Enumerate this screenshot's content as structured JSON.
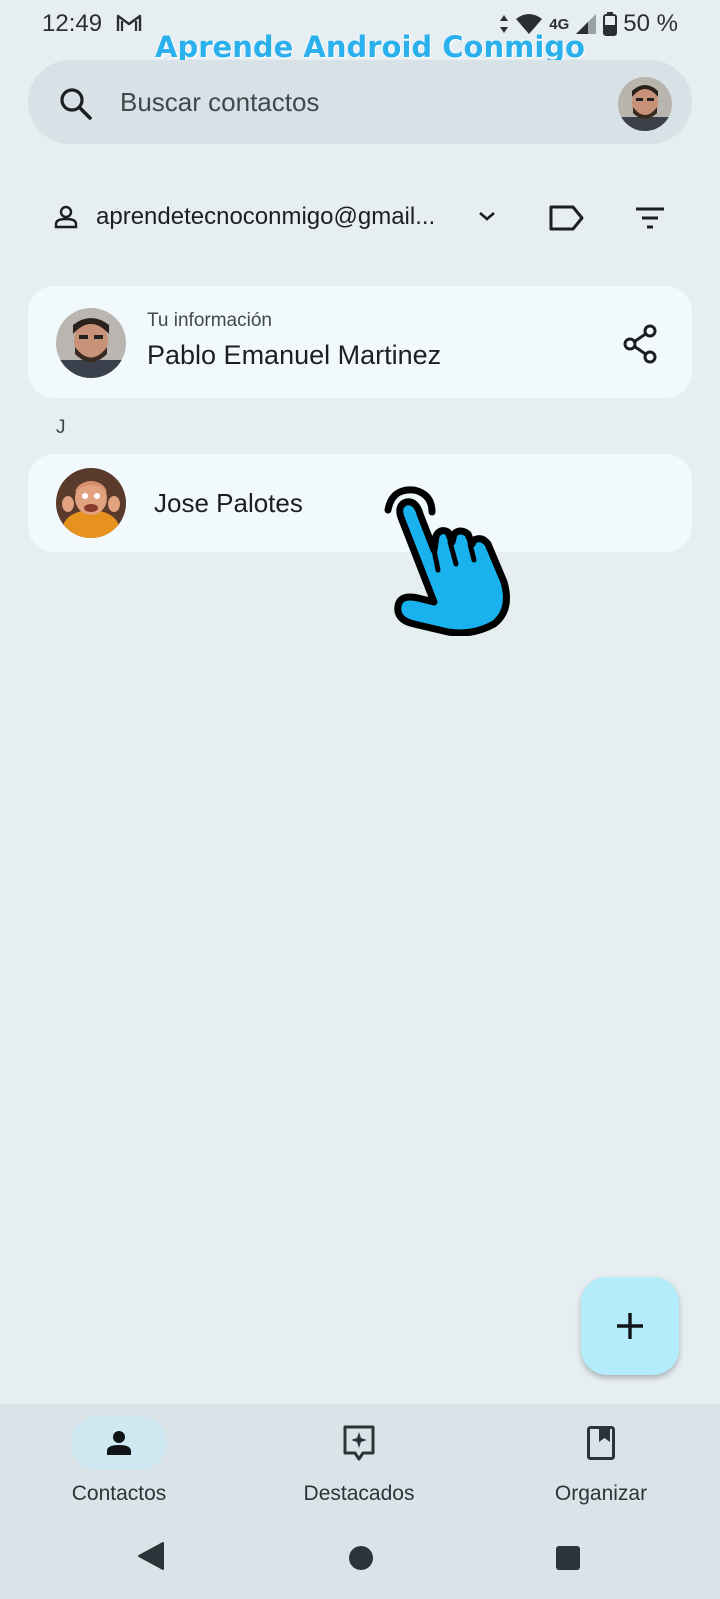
{
  "status_bar": {
    "time": "12:49",
    "network": "4G",
    "battery": "50 %"
  },
  "watermark": "Aprende Android Conmigo",
  "search": {
    "placeholder": "Buscar contactos"
  },
  "account": {
    "email": "aprendetecnoconmigo@gmail..."
  },
  "my_info": {
    "caption": "Tu información",
    "name": "Pablo Emanuel Martinez"
  },
  "section_letter": "J",
  "contacts": [
    {
      "name": "Jose Palotes"
    }
  ],
  "bottom_nav": {
    "items": [
      {
        "label": "Contactos",
        "icon": "person-icon",
        "active": true
      },
      {
        "label": "Destacados",
        "icon": "sparkle-icon",
        "active": false
      },
      {
        "label": "Organizar",
        "icon": "bookmark-book-icon",
        "active": false
      }
    ]
  },
  "colors": {
    "background": "#e6eef2",
    "card": "#f2f9fc",
    "fab": "#b4ecfb",
    "watermark": "#2ab0ec",
    "hand": "#19b2ef"
  }
}
